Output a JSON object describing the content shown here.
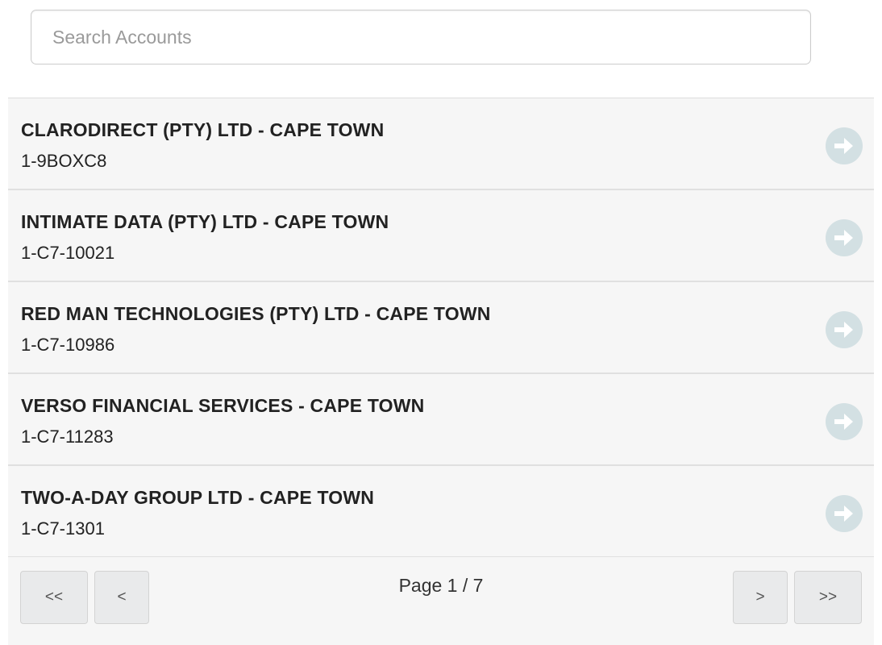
{
  "search": {
    "placeholder": "Search Accounts",
    "value": ""
  },
  "accounts": [
    {
      "name": "CLARODIRECT (PTY) LTD - CAPE TOWN",
      "id": "1-9BOXC8"
    },
    {
      "name": "INTIMATE DATA (PTY) LTD - CAPE TOWN",
      "id": "1-C7-10021"
    },
    {
      "name": "RED MAN TECHNOLOGIES (PTY) LTD - CAPE TOWN",
      "id": "1-C7-10986"
    },
    {
      "name": "VERSO FINANCIAL SERVICES - CAPE TOWN",
      "id": "1-C7-11283"
    },
    {
      "name": "TWO-A-DAY GROUP LTD - CAPE TOWN",
      "id": "1-C7-1301"
    }
  ],
  "row_icon": "arrow-right-circle-icon",
  "pagination": {
    "first_label": "<<",
    "prev_label": "<",
    "page_text": "Page 1 / 7",
    "next_label": ">",
    "last_label": ">>"
  },
  "colors": {
    "arrow_icon": "#d3e0e3",
    "row_background": "#f6f6f6",
    "button_background": "#e9eaeb"
  }
}
